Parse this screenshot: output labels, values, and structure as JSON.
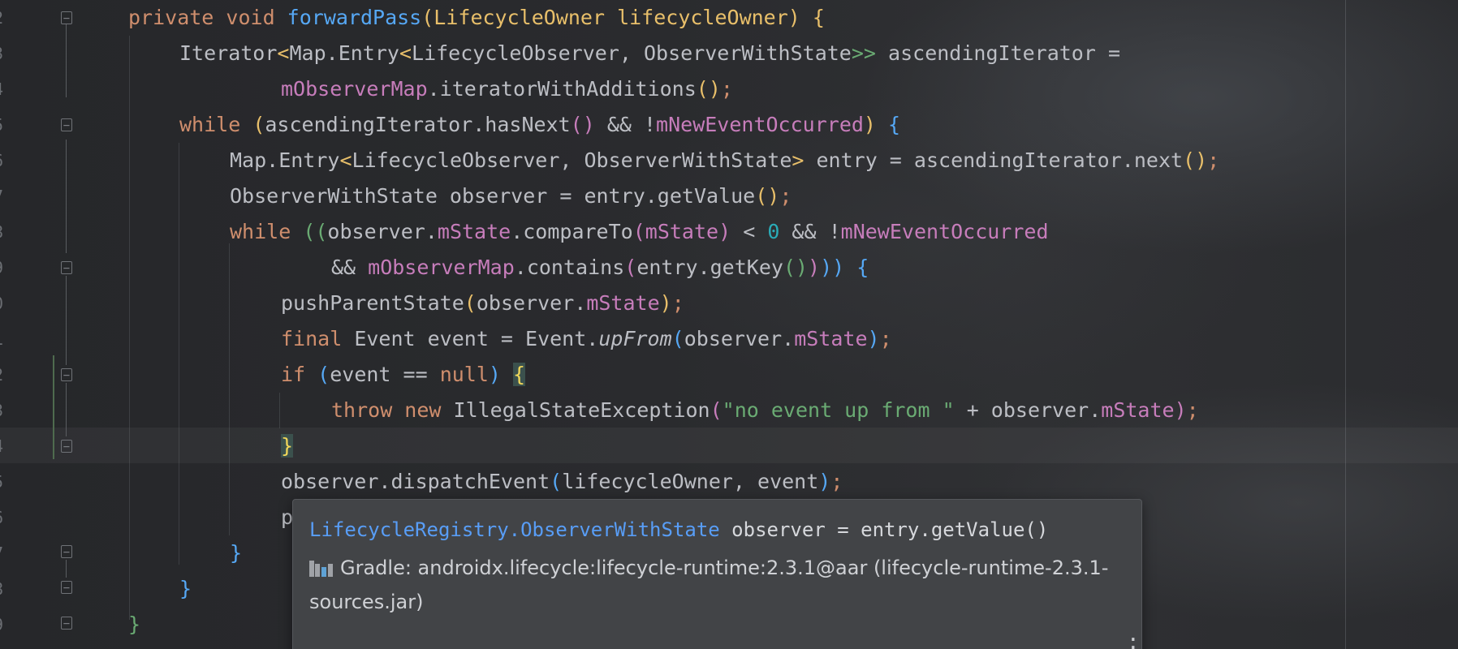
{
  "editor": {
    "gutter_numbers": [
      "2",
      "3",
      "4",
      "5",
      "6",
      "7",
      "8",
      "9",
      "0",
      "1",
      "2",
      "3",
      "4",
      "5",
      "6",
      "7",
      "8",
      "9"
    ],
    "lines": {
      "l1": {
        "a": "private void ",
        "b": "forwardPass",
        "c": "(LifecycleOwner lifecycleOwner) ",
        "d": "{"
      },
      "l2": {
        "a": "Iterator",
        "b": "<",
        "c": "Map.Entry",
        "d": "<",
        "e": "LifecycleObserver, ObserverWithState",
        "f": ">>",
        "g": " ascendingIterator ="
      },
      "l3": {
        "a": "mObserverMap",
        "b": ".iteratorWithAdditions",
        "c": "()",
        "d": ";"
      },
      "l4": {
        "a": "while ",
        "b": "(",
        "c": "ascendingIterator.hasNext",
        "d": "()",
        "e": " && !",
        "f": "mNewEventOccurred",
        "g": ") ",
        "h": "{"
      },
      "l5": {
        "a": "Map.Entry",
        "b": "<",
        "c": "LifecycleObserver, ObserverWithState",
        "d": ">",
        "e": " entry = ascendingIterator.next",
        "f": "()",
        "g": ";"
      },
      "l6": {
        "a": "ObserverWithState observer = entry.getValue",
        "b": "()",
        "c": ";"
      },
      "l7": {
        "a": "while ",
        "b": "((",
        "c": "observer.",
        "d": "mState",
        "e": ".compareTo",
        "f": "(",
        "g": "mState",
        "h": ")",
        "i": " < ",
        "j": "0",
        "k": " && !",
        "l": "mNewEventOccurred"
      },
      "l8": {
        "a": "&& ",
        "b": "mObserverMap",
        "c": ".contains",
        "d": "(",
        "e": "entry.getKey",
        "f": "()",
        "g": ")",
        "h": "))",
        "i": " {"
      },
      "l9": {
        "a": "pushParentState",
        "b": "(",
        "c": "observer.",
        "d": "mState",
        "e": ")",
        "f": ";"
      },
      "l10": {
        "a": "final ",
        "b": "Event event = Event.",
        "c": "upFrom",
        "d": "(",
        "e": "observer.",
        "f": "mState",
        "g": ")",
        "h": ";"
      },
      "l11": {
        "a": "if ",
        "b": "(",
        "c": "event == ",
        "d": "null",
        "e": ") ",
        "f": "{"
      },
      "l12": {
        "a": "throw new ",
        "b": "IllegalStateException",
        "c": "(",
        "d": "\"no event up from \"",
        "e": " + observer.",
        "f": "mState",
        "g": ")",
        "h": ";"
      },
      "l13": {
        "a": "}"
      },
      "l14": {
        "a": "observer.dispatchEvent",
        "b": "(",
        "c": "lifecycleOwner, event",
        "d": ")",
        "e": ";"
      },
      "l15": {
        "a": "p"
      },
      "l16": {
        "a": "}"
      },
      "l17": {
        "a": "}"
      },
      "l18": {
        "a": "}"
      }
    }
  },
  "popup": {
    "signature_link": "LifecycleRegistry.ObserverWithState",
    "signature_rest": " observer = entry.getValue()",
    "source_text": "Gradle: androidx.lifecycle:lifecycle-runtime:2.3.1@aar (lifecycle-runtime-2.3.1-sources.jar)",
    "icon": "library-icon",
    "more_icon": "more-vertical-icon"
  },
  "colors": {
    "keyword": "#cf8e6d",
    "function": "#56a8f5",
    "field": "#c77dbb",
    "number": "#2aacb8",
    "string": "#6aab73",
    "text": "#bcbec4"
  }
}
